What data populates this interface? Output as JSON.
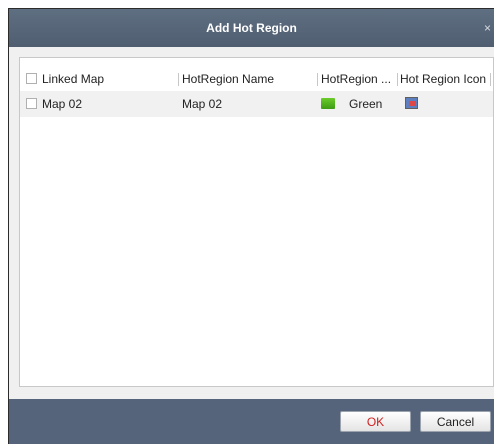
{
  "dialog": {
    "title": "Add Hot Region",
    "close_glyph": "×"
  },
  "table": {
    "columns": [
      "Linked Map",
      "HotRegion Name",
      "HotRegion ...",
      "Hot Region Icon"
    ],
    "rows": [
      {
        "linked_map": "Map 02",
        "hotregion_name": "Map 02",
        "hotregion_color": "Green",
        "color_hex": "#4fb51f",
        "icon": "map-icon"
      }
    ]
  },
  "footer": {
    "ok_label": "OK",
    "cancel_label": "Cancel"
  }
}
